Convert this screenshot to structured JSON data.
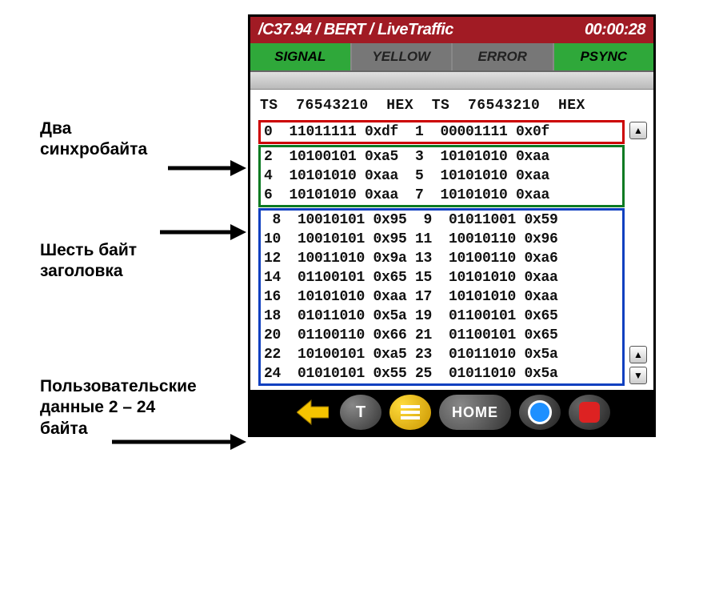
{
  "annotations": {
    "sync": "Два\nсинхробайта",
    "header": "Шесть байт\nзаголовка",
    "user": "Пользовательские\nданные 2 – 24\nбайта"
  },
  "titlebar": {
    "path": "/C37.94 / BERT / LiveTraffic",
    "time": "00:00:28"
  },
  "status": {
    "signal": "SIGNAL",
    "yellow": "YELLOW",
    "error": "ERROR",
    "psync": "PSYNC"
  },
  "columns": "TS  76543210  HEX  TS  76543210  HEX",
  "rows": {
    "sync": [
      "0  11011111 0xdf  1  00001111 0x0f"
    ],
    "header": [
      "2  10100101 0xa5  3  10101010 0xaa",
      "4  10101010 0xaa  5  10101010 0xaa",
      "6  10101010 0xaa  7  10101010 0xaa"
    ],
    "user": [
      " 8  10010101 0x95  9  01011001 0x59",
      "10  10010101 0x95 11  10010110 0x96",
      "12  10011010 0x9a 13  10100110 0xa6",
      "14  01100101 0x65 15  10101010 0xaa",
      "16  10101010 0xaa 17  10101010 0xaa",
      "18  01011010 0x5a 19  01100101 0x65",
      "20  01100110 0x66 21  01100101 0x65",
      "22  10100101 0xa5 23  01011010 0x5a",
      "24  01010101 0x55 25  01011010 0x5a"
    ]
  },
  "toolbar": {
    "t": "T",
    "home": "HOME"
  },
  "icons": {
    "back": "back-arrow-icon",
    "menu": "menu-icon",
    "refresh": "refresh-icon",
    "stop": "stop-icon",
    "up": "▲",
    "down": "▼"
  }
}
